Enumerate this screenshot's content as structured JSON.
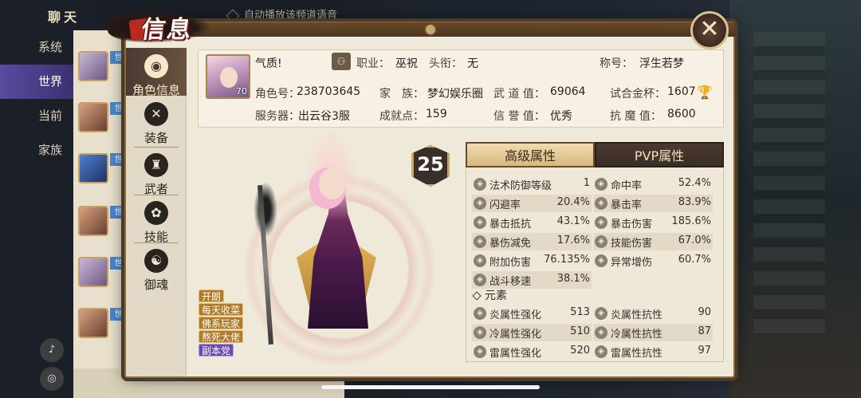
{
  "chat": {
    "title": "聊天",
    "auto_play": "自动播放该频道语音",
    "tabs": [
      {
        "label": "系统"
      },
      {
        "label": "世界"
      },
      {
        "label": "当前"
      },
      {
        "label": "家族"
      }
    ],
    "channel_tag": "世",
    "voice_icon": "speaker-icon",
    "mic_icon": "microphone-icon"
  },
  "dialog": {
    "title": "信息",
    "close": "✕"
  },
  "nav": [
    {
      "label": "角色信息",
      "icon": "◉"
    },
    {
      "label": "装备",
      "icon": "✕"
    },
    {
      "label": "武者",
      "icon": "♜"
    },
    {
      "label": "技能",
      "icon": "✿"
    },
    {
      "label": "御魂",
      "icon": "☯"
    }
  ],
  "profile": {
    "level": "70",
    "temperament": "气质!",
    "job_label": "职业：",
    "job": "巫祝",
    "title_label": "头衔：",
    "title": "无",
    "nickname_label": "称号：",
    "nickname": "浮生若梦",
    "role_id_label": "角色号：",
    "role_id": "238703645",
    "family_label": "家　族：",
    "family": "梦幻娱乐圈",
    "martial_label": "武 道 值：",
    "martial": "69064",
    "trial_label": "试合金杯：",
    "trial": "1607",
    "server_label": "服务器：",
    "server": "出云谷3服",
    "achievement_label": "成就点：",
    "achievement": "159",
    "credit_label": "信 誉 值：",
    "credit": "优秀",
    "anti_demon_label": "抗 魔 值：",
    "anti_demon": "8600"
  },
  "character": {
    "badge_level": "25",
    "tags": [
      "开朗",
      "每天收菜",
      "佛系玩家",
      "熬死大佬",
      "副本党"
    ]
  },
  "attributes": {
    "tab_advanced": "高级属性",
    "tab_pvp": "PVP属性",
    "rows": [
      {
        "name": "法术防御等级",
        "value": "1"
      },
      {
        "name": "命中率",
        "value": "52.4%"
      },
      {
        "name": "闪避率",
        "value": "20.4%"
      },
      {
        "name": "暴击率",
        "value": "83.9%"
      },
      {
        "name": "暴击抵抗",
        "value": "43.1%"
      },
      {
        "name": "暴击伤害",
        "value": "185.6%"
      },
      {
        "name": "暴伤减免",
        "value": "17.6%"
      },
      {
        "name": "技能伤害",
        "value": "67.0%"
      },
      {
        "name": "附加伤害",
        "value": "76.135%"
      },
      {
        "name": "异常增伤",
        "value": "60.7%"
      },
      {
        "name": "战斗移速",
        "value": "38.1%"
      }
    ],
    "element_section": "元素",
    "element_rows": [
      {
        "name": "炎属性强化",
        "value": "513"
      },
      {
        "name": "炎属性抗性",
        "value": "90"
      },
      {
        "name": "冷属性强化",
        "value": "510"
      },
      {
        "name": "冷属性抗性",
        "value": "87"
      },
      {
        "name": "雷属性强化",
        "value": "520"
      },
      {
        "name": "雷属性抗性",
        "value": "97"
      }
    ]
  }
}
